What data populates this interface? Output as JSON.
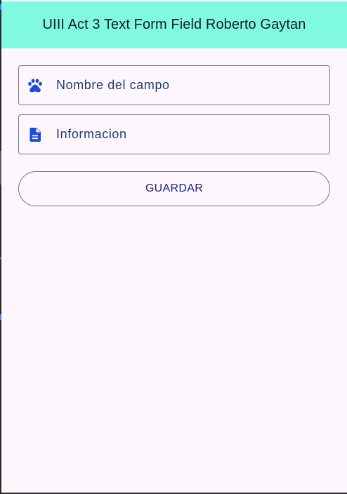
{
  "app_bar": {
    "title": "UIII Act 3 Text Form Field Roberto Gaytan",
    "background": "#7ffae0"
  },
  "form": {
    "fields": [
      {
        "icon": "paw-icon",
        "placeholder": "Nombre del campo",
        "value": ""
      },
      {
        "icon": "document-icon",
        "placeholder": "Informacion",
        "value": ""
      }
    ],
    "icon_color": "#1a4fd6",
    "save_label": "GUARDAR"
  },
  "colors": {
    "background": "#fdf6fd",
    "outline": "#79747e",
    "text": "#1f3d6e",
    "button_text": "#1a237e"
  }
}
